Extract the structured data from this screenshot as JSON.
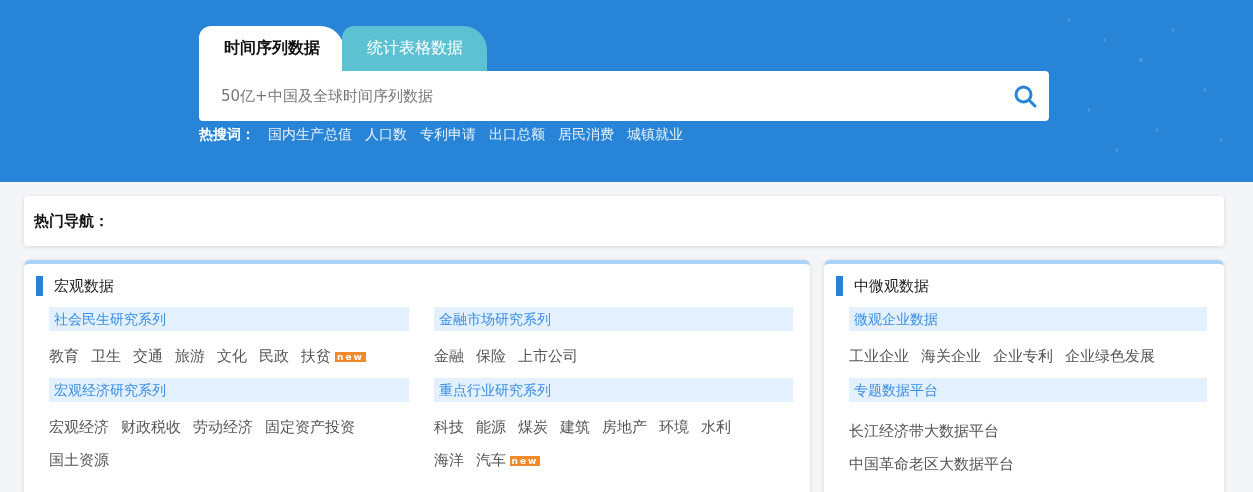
{
  "tabs": [
    {
      "label": "时间序列数据",
      "selected": true
    },
    {
      "label": "统计表格数据",
      "selected": false
    }
  ],
  "search": {
    "placeholder": "50亿+中国及全球时间序列数据"
  },
  "hot_words": {
    "label": "热搜词：",
    "items": [
      "国内生产总值",
      "人口数",
      "专利申请",
      "出口总额",
      "居民消费",
      "城镇就业"
    ]
  },
  "hot_nav": {
    "label": "热门导航："
  },
  "panels": [
    {
      "title": "宏观数据",
      "columns": [
        [
          {
            "title": "社会民生研究系列",
            "kind": "inline",
            "rows": [
              [
                {
                  "label": "教育"
                },
                {
                  "label": "卫生"
                },
                {
                  "label": "交通"
                },
                {
                  "label": "旅游"
                },
                {
                  "label": "文化"
                },
                {
                  "label": "民政"
                },
                {
                  "label": "扶贫",
                  "badge": "new"
                }
              ]
            ]
          },
          {
            "title": "宏观经济研究系列",
            "kind": "inline",
            "rows": [
              [
                {
                  "label": "宏观经济"
                },
                {
                  "label": "财政税收"
                },
                {
                  "label": "劳动经济"
                },
                {
                  "label": "固定资产投资"
                }
              ],
              [
                {
                  "label": "国土资源"
                }
              ]
            ]
          }
        ],
        [
          {
            "title": "金融市场研究系列",
            "kind": "inline",
            "rows": [
              [
                {
                  "label": "金融"
                },
                {
                  "label": "保险"
                },
                {
                  "label": "上市公司"
                }
              ]
            ]
          },
          {
            "title": "重点行业研究系列",
            "kind": "inline",
            "rows": [
              [
                {
                  "label": "科技"
                },
                {
                  "label": "能源"
                },
                {
                  "label": "煤炭"
                },
                {
                  "label": "建筑"
                },
                {
                  "label": "房地产"
                },
                {
                  "label": "环境"
                },
                {
                  "label": "水利"
                }
              ],
              [
                {
                  "label": "海洋"
                },
                {
                  "label": "汽车",
                  "badge": "new"
                }
              ]
            ]
          }
        ]
      ]
    },
    {
      "title": "中微观数据",
      "columns": [
        [
          {
            "title": "微观企业数据",
            "kind": "inline",
            "rows": [
              [
                {
                  "label": "工业企业"
                },
                {
                  "label": "海关企业"
                },
                {
                  "label": "企业专利"
                },
                {
                  "label": "企业绿色发展"
                }
              ]
            ]
          },
          {
            "title": "专题数据平台",
            "kind": "stacked",
            "rows": [
              [
                {
                  "label": "长江经济带大数据平台"
                }
              ],
              [
                {
                  "label": "中国革命老区大数据平台"
                }
              ]
            ]
          }
        ]
      ]
    }
  ]
}
